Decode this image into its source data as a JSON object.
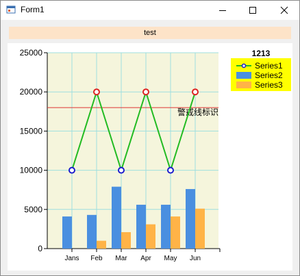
{
  "window": {
    "title": "Form1",
    "controls": [
      "minimize-icon",
      "maximize-icon",
      "close-icon"
    ]
  },
  "banner": {
    "text": "test"
  },
  "colors": {
    "plot_bg": "#f5f5dc",
    "grid": "#9edfdf",
    "series1_line": "#22bb22",
    "marker_low": "#1a1acc",
    "marker_high": "#dd2222",
    "series2": "#4a8fe0",
    "series3": "#ffb347",
    "warning_line": "#dd3333",
    "legend_bg": "#ffff00"
  },
  "chart_data": {
    "type": "bar",
    "categories": [
      "Jans",
      "Feb",
      "Mar",
      "Apr",
      "May",
      "Jun"
    ],
    "ylim": [
      0,
      25000
    ],
    "yticks": [
      0,
      5000,
      10000,
      15000,
      20000,
      25000
    ],
    "grid": true,
    "series": [
      {
        "name": "Series1",
        "type": "line",
        "values": [
          10000,
          20000,
          10000,
          20000,
          10000,
          20000
        ]
      },
      {
        "name": "Series2",
        "type": "bar",
        "values": [
          4100,
          4300,
          7900,
          5600,
          5600,
          7600
        ]
      },
      {
        "name": "Series3",
        "type": "bar",
        "values": [
          0,
          1000,
          2100,
          3100,
          4100,
          5100
        ]
      }
    ],
    "reference_line": {
      "value": 18000,
      "label": "警戒线标识"
    },
    "legend": {
      "title": "1213",
      "position": "top-right",
      "items": [
        "Series1",
        "Series2",
        "Series3"
      ]
    }
  }
}
